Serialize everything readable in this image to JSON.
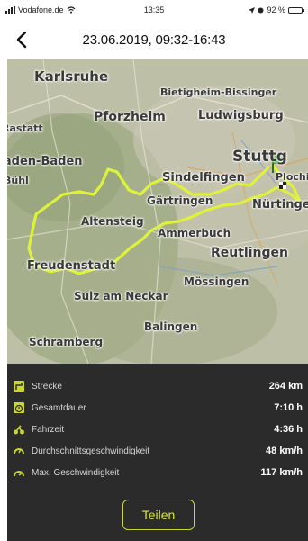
{
  "status_bar": {
    "carrier": "Vodafone.de",
    "time": "13:35",
    "battery": "92 %"
  },
  "header": {
    "back_icon": "chevron-left-icon",
    "title": "23.06.2019, 09:32-16:43"
  },
  "map": {
    "cities": [
      {
        "name": "Karlsruhe"
      },
      {
        "name": "Bietigheim-Bissinger"
      },
      {
        "name": "Rastatt"
      },
      {
        "name": "Pforzheim"
      },
      {
        "name": "Ludwigsburg"
      },
      {
        "name": "Baden-Baden"
      },
      {
        "name": "Stuttg"
      },
      {
        "name": "Bühl"
      },
      {
        "name": "Sindelfingen"
      },
      {
        "name": "Plochi"
      },
      {
        "name": "Gärtringen"
      },
      {
        "name": "Nürtinge"
      },
      {
        "name": "Altensteig"
      },
      {
        "name": "Ammerbuch"
      },
      {
        "name": "Reutlingen"
      },
      {
        "name": "Freudenstadt"
      },
      {
        "name": "Mössingen"
      },
      {
        "name": "Sulz am Neckar"
      },
      {
        "name": "Balingen"
      },
      {
        "name": "Schramberg"
      }
    ],
    "route_color": "#dff23a",
    "flag_color": "#3fae2a"
  },
  "stats": [
    {
      "icon": "route-icon",
      "label": "Strecke",
      "value": "264 km"
    },
    {
      "icon": "stopwatch-icon",
      "label": "Gesamtdauer",
      "value": "7:10 h"
    },
    {
      "icon": "motorcycle-icon",
      "label": "Fahrzeit",
      "value": "4:36 h"
    },
    {
      "icon": "speedometer-icon",
      "label": "Durchschnittsgeschwindigkeit",
      "value": "48 km/h"
    },
    {
      "icon": "gauge-max-icon",
      "label": "Max. Geschwindigkeit",
      "value": "117 km/h"
    }
  ],
  "share_button": "Teilen",
  "accent_color": "#d6e23a"
}
